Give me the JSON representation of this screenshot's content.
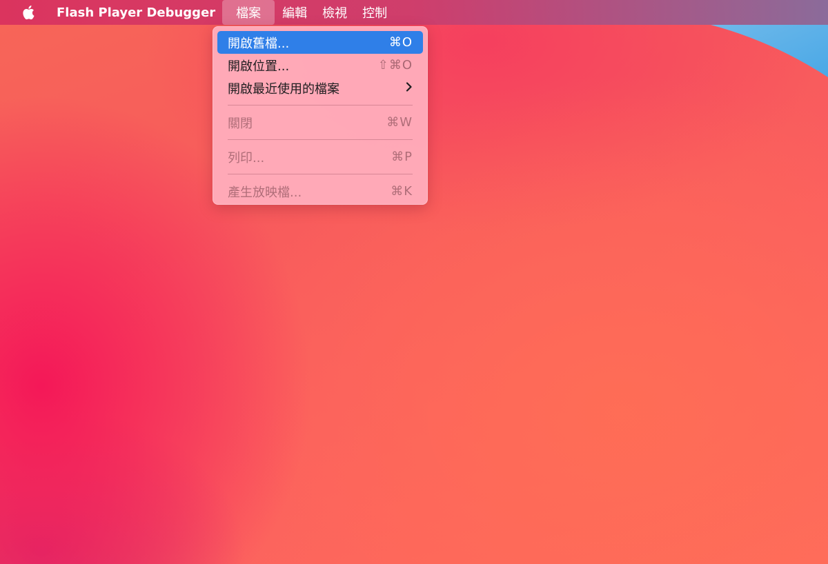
{
  "menubar": {
    "apple_icon": "apple-logo-icon",
    "app_name": "Flash Player Debugger",
    "menus": [
      {
        "label": "檔案",
        "active": true
      },
      {
        "label": "編輯",
        "active": false
      },
      {
        "label": "檢視",
        "active": false
      },
      {
        "label": "控制",
        "active": false
      }
    ]
  },
  "file_menu": {
    "items": [
      {
        "label": "開啟舊檔...",
        "shortcut": "⌘O",
        "state": "highlighted"
      },
      {
        "label": "開啟位置...",
        "shortcut": "⇧⌘O",
        "state": "enabled"
      },
      {
        "label": "開啟最近使用的檔案",
        "submenu_icon": "chevron-right-icon",
        "state": "enabled"
      },
      {
        "label": "關閉",
        "shortcut": "⌘W",
        "state": "disabled"
      },
      {
        "label": "列印...",
        "shortcut": "⌘P",
        "state": "disabled"
      },
      {
        "label": "產生放映檔...",
        "shortcut": "⌘K",
        "state": "disabled"
      }
    ]
  },
  "colors": {
    "highlight": "#2f7fe8",
    "menu_background": "#ffafbe",
    "wallpaper_primary": "#f75a5c",
    "wallpaper_accent_blue": "#5ab4e8"
  }
}
